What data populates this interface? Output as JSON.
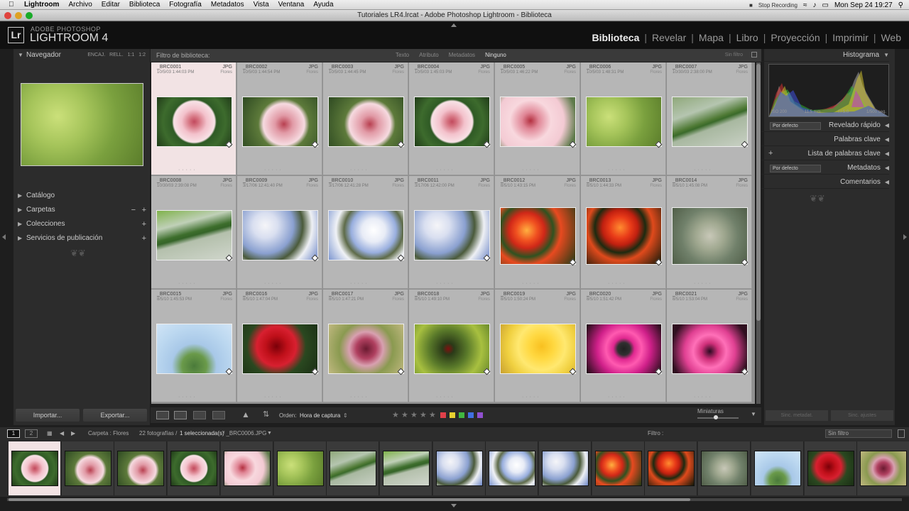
{
  "menubar": {
    "app": "Lightroom",
    "items": [
      "Archivo",
      "Editar",
      "Biblioteca",
      "Fotografía",
      "Metadatos",
      "Vista",
      "Ventana",
      "Ayuda"
    ],
    "stop_recording": "Stop Recording",
    "clock": "Mon Sep 24  19:27"
  },
  "window": {
    "title": "Tutoriales LR4.lrcat - Adobe Photoshop Lightroom - Biblioteca"
  },
  "identity": {
    "brand_small": "ADOBE PHOTOSHOP",
    "brand_large": "LIGHTROOM 4",
    "logo": "Lr"
  },
  "modules": [
    {
      "label": "Biblioteca",
      "active": true
    },
    {
      "label": "Revelar",
      "active": false
    },
    {
      "label": "Mapa",
      "active": false
    },
    {
      "label": "Libro",
      "active": false
    },
    {
      "label": "Proyección",
      "active": false
    },
    {
      "label": "Imprimir",
      "active": false
    },
    {
      "label": "Web",
      "active": false
    }
  ],
  "left": {
    "navigator": "Navegador",
    "nav_options": "ENCAJ.  RELL.  1:1  1:2",
    "sections": [
      {
        "label": "Catálogo",
        "minus": false,
        "plus": false
      },
      {
        "label": "Carpetas",
        "minus": true,
        "plus": true
      },
      {
        "label": "Colecciones",
        "minus": false,
        "plus": true
      },
      {
        "label": "Servicios de publicación",
        "minus": false,
        "plus": true
      }
    ],
    "import_button": "Importar...",
    "export_button": "Exportar..."
  },
  "filterbar": {
    "label": "Filtro de biblioteca:",
    "tabs": [
      {
        "label": "Texto",
        "active": false
      },
      {
        "label": "Atributo",
        "active": false
      },
      {
        "label": "Metadatos",
        "active": false
      },
      {
        "label": "Ninguno",
        "active": true
      }
    ],
    "preset": "Sin filtro"
  },
  "grid": {
    "category": "Flores",
    "cells": [
      {
        "name": "_BRC0001",
        "ext": "JPG",
        "date": "10/5/03 1:44:03 PM",
        "photo": "p-hibiscus",
        "selected": true
      },
      {
        "name": "_BRC0002",
        "ext": "JPG",
        "date": "10/5/03 1:44:54 PM",
        "photo": "p-hibiscus2",
        "selected": false
      },
      {
        "name": "_BRC0003",
        "ext": "JPG",
        "date": "10/5/03 1:44:45 PM",
        "photo": "p-hibiscus2",
        "selected": false
      },
      {
        "name": "_BRC0004",
        "ext": "JPG",
        "date": "10/5/03 1:45:03 PM",
        "photo": "p-hibiscus",
        "selected": false
      },
      {
        "name": "_BRC0005",
        "ext": "JPG",
        "date": "10/5/03 1:46:22 PM",
        "photo": "p-hibiscus-close",
        "selected": false
      },
      {
        "name": "_BRC0006",
        "ext": "JPG",
        "date": "10/5/03 1:48:31 PM",
        "photo": "p-leaves",
        "selected": false
      },
      {
        "name": "_BRC0007",
        "ext": "JPG",
        "date": "10/30/03 2:38:00 PM",
        "photo": "p-stem",
        "selected": false
      },
      {
        "name": "_BRC0008",
        "ext": "JPG",
        "date": "10/30/03 2:39:08 PM",
        "photo": "p-stem2",
        "selected": false
      },
      {
        "name": "_BRC0009",
        "ext": "JPG",
        "date": "3/17/06 12:41:40 PM",
        "photo": "p-blossom",
        "selected": false
      },
      {
        "name": "_BRC0010",
        "ext": "JPG",
        "date": "3/17/06 12:41:28 PM",
        "photo": "p-blossom2",
        "selected": false
      },
      {
        "name": "_BRC0011",
        "ext": "JPG",
        "date": "3/17/06 12:42:00 PM",
        "photo": "p-blossom",
        "selected": false
      },
      {
        "name": "_BRC0012",
        "ext": "JPG",
        "date": "8/5/10 1:43:15 PM",
        "photo": "p-lantana",
        "selected": false
      },
      {
        "name": "_BRC0013",
        "ext": "JPG",
        "date": "8/5/10 1:44:33 PM",
        "photo": "p-lantana2",
        "selected": false
      },
      {
        "name": "_BRC0014",
        "ext": "JPG",
        "date": "8/5/10 1:45:08 PM",
        "photo": "p-moss",
        "selected": false
      },
      {
        "name": "_BRC0015",
        "ext": "JPG",
        "date": "8/5/10 1:45:53 PM",
        "photo": "p-agave",
        "selected": false
      },
      {
        "name": "_BRC0016",
        "ext": "JPG",
        "date": "8/5/10 1:47:04 PM",
        "photo": "p-rose",
        "selected": false
      },
      {
        "name": "_BRC0017",
        "ext": "JPG",
        "date": "8/5/10 1:47:21 PM",
        "photo": "p-rose2",
        "selected": false
      },
      {
        "name": "_BRC0018",
        "ext": "JPG",
        "date": "8/5/10 1:49:10 PM",
        "photo": "p-ladybug",
        "selected": false
      },
      {
        "name": "_BRC0019",
        "ext": "JPG",
        "date": "8/5/10 1:50:24 PM",
        "photo": "p-yellow",
        "selected": false
      },
      {
        "name": "_BRC0020",
        "ext": "JPG",
        "date": "8/5/10 1:51:42 PM",
        "photo": "p-pink",
        "selected": false
      },
      {
        "name": "_BRC0021",
        "ext": "JPG",
        "date": "8/5/10 1:53:04 PM",
        "photo": "p-pink2",
        "selected": false
      }
    ]
  },
  "toolbar": {
    "sort_label": "Orden:",
    "sort_value": "Hora de captura",
    "label_colors": [
      "#e0404a",
      "#e8d030",
      "#40b840",
      "#4070e0",
      "#9050d0"
    ]
  },
  "right": {
    "histogram": "Histograma",
    "hist_info": [
      "ISO 200",
      "11.5 mm",
      "f / 5.0",
      "1/500 seg."
    ],
    "quick_develop": "Revelado rápido",
    "quick_preset": "Por defecto",
    "keywords": "Palabras clave",
    "keyword_list": "Lista de palabras clave",
    "metadata": "Metadatos",
    "metadata_preset": "Por defecto",
    "comments": "Comentarios",
    "sync_metadata": "Sinc. metadat.",
    "sync_settings": "Sinc. ajustes"
  },
  "filmbar": {
    "page1": "1",
    "page2": "2",
    "source": "Carpeta : Flores",
    "count": "22 fotografías / ",
    "selected": "1 seleccionada(s)",
    "file": " / _BRC0006.JPG",
    "filter_label": "Filtro :",
    "filter_value": "Sin filtro"
  },
  "filmstrip": {
    "photos": [
      "p-hibiscus",
      "p-hibiscus2",
      "p-hibiscus2",
      "p-hibiscus",
      "p-hibiscus-close",
      "p-leaves",
      "p-stem",
      "p-stem2",
      "p-blossom",
      "p-blossom2",
      "p-blossom",
      "p-lantana",
      "p-lantana2",
      "p-moss",
      "p-agave",
      "p-rose",
      "p-rose2"
    ],
    "selected_index": 0
  },
  "toolbar_thumb": {
    "label": "Miniaturas"
  },
  "colors": {
    "accent_active": "#eeeeee",
    "selected_cell": "#f2e3e4",
    "grid_bg": "#b6b6b6"
  }
}
